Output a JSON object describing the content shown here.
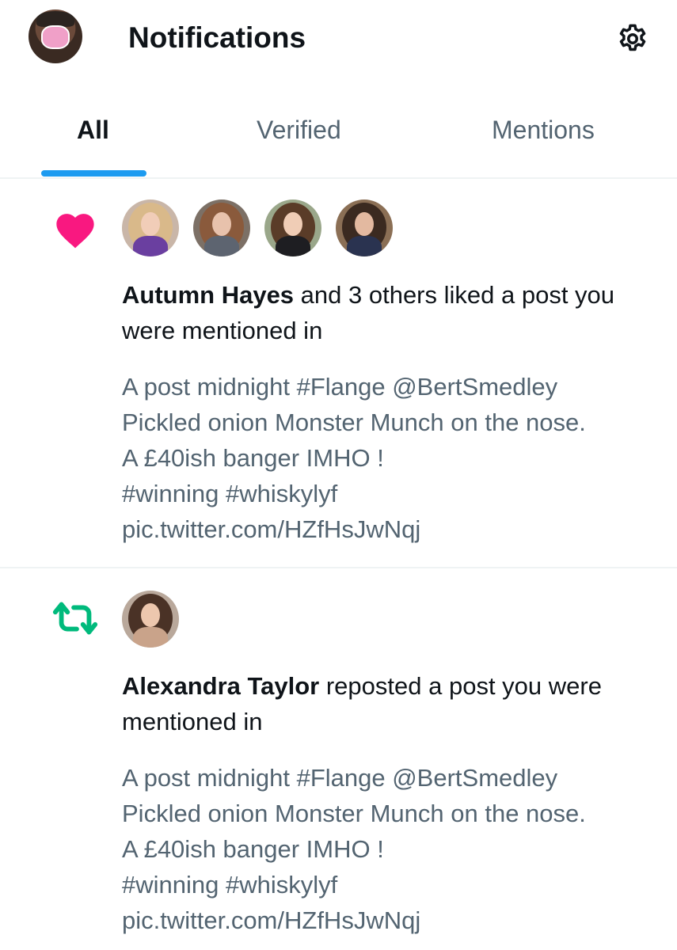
{
  "header": {
    "title": "Notifications",
    "avatar_icon": "profile-avatar",
    "settings_icon": "gear-icon"
  },
  "tabs": [
    {
      "label": "All",
      "active": true
    },
    {
      "label": "Verified",
      "active": false
    },
    {
      "label": "Mentions",
      "active": false
    }
  ],
  "colors": {
    "accent": "#1d9bf0",
    "like": "#f91880",
    "repost": "#00ba7c",
    "secondary_text": "#536471"
  },
  "notifications": [
    {
      "type_icon": "heart-icon",
      "actor_name": "Autumn Hayes",
      "action_text": " and 3 others liked a post you were mentioned in",
      "post_lines": [
        "A post midnight #Flange @BertSmedley",
        "Pickled onion Monster Munch on the nose.",
        "A £40ish banger IMHO !",
        "#winning #whiskylyf",
        "pic.twitter.com/HZfHsJwNqj"
      ]
    },
    {
      "type_icon": "repost-icon",
      "actor_name": "Alexandra Taylor",
      "action_text": " reposted a post you were mentioned in",
      "post_lines": [
        "A post midnight #Flange @BertSmedley",
        "Pickled onion Monster Munch on the nose.",
        "A £40ish banger IMHO !",
        "#winning #whiskylyf",
        "pic.twitter.com/HZfHsJwNqj"
      ]
    }
  ]
}
